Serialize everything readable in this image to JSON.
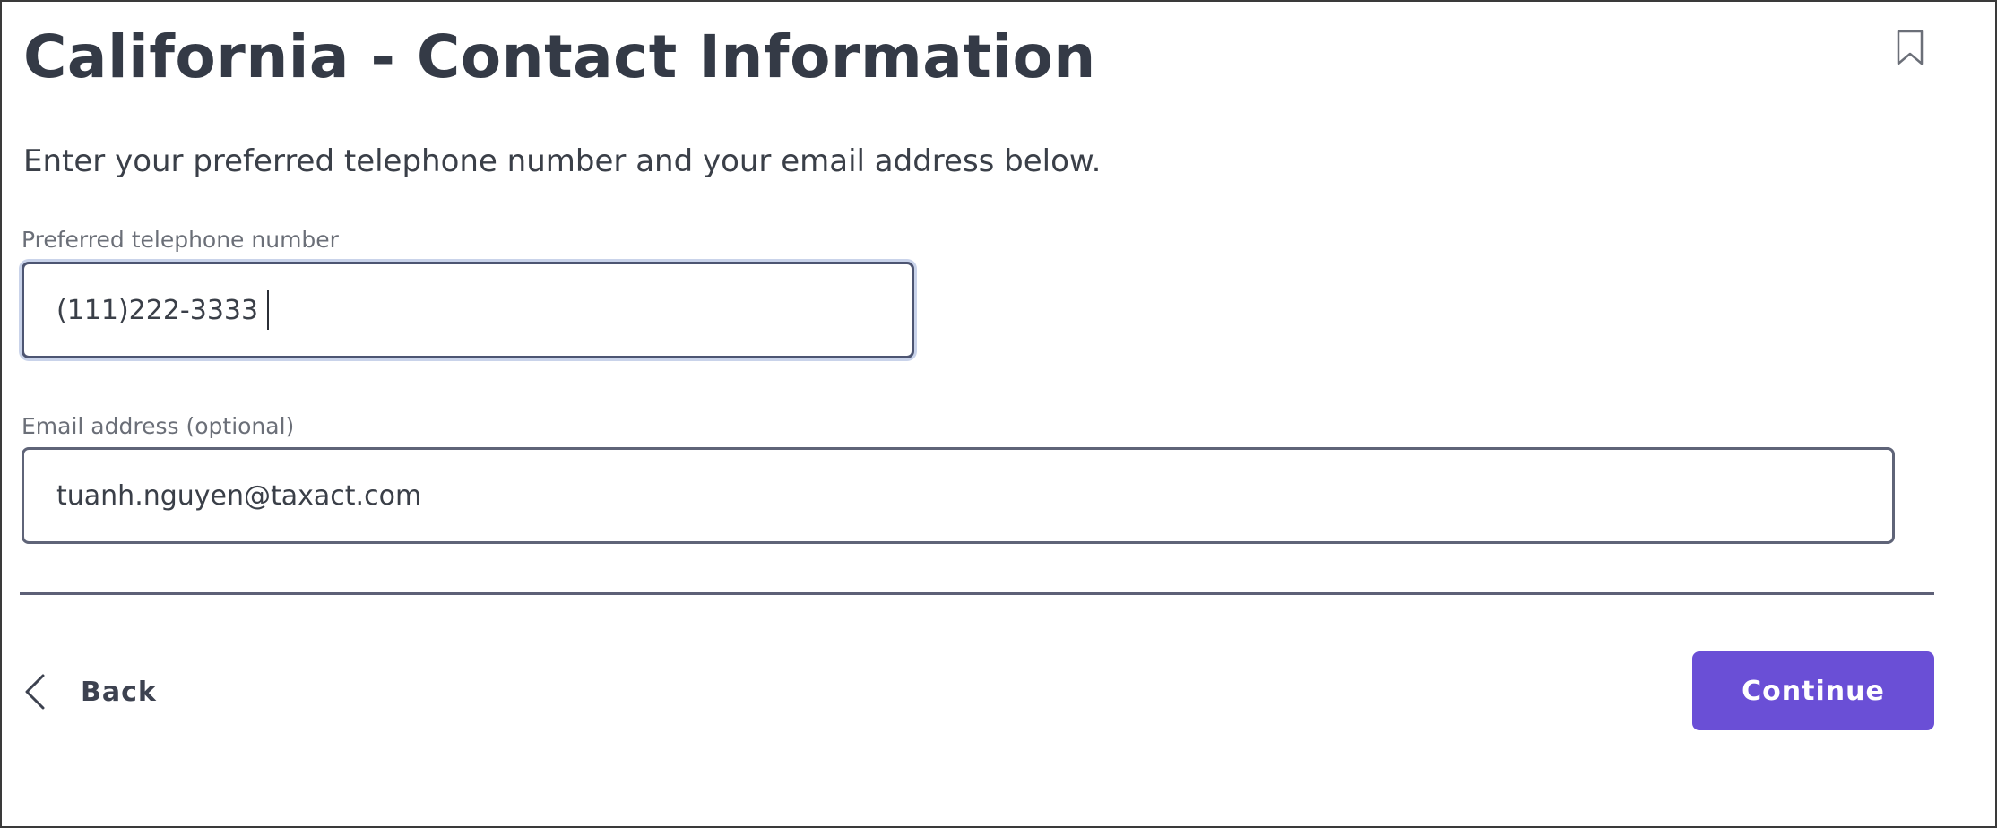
{
  "page": {
    "title": "California - Contact Information",
    "intro": "Enter your preferred telephone number and your email address below."
  },
  "form": {
    "phone": {
      "label": "Preferred telephone number",
      "value": "(111)222-3333"
    },
    "email": {
      "label": "Email address (optional)",
      "value": "tuanh.nguyen@taxact.com"
    }
  },
  "nav": {
    "back_label": "Back",
    "continue_label": "Continue"
  },
  "icons": {
    "bookmark": "bookmark-icon",
    "back": "chevron-left-icon"
  },
  "colors": {
    "primary": "#6a4fd6",
    "text": "#343a46",
    "border": "#5f6478"
  }
}
